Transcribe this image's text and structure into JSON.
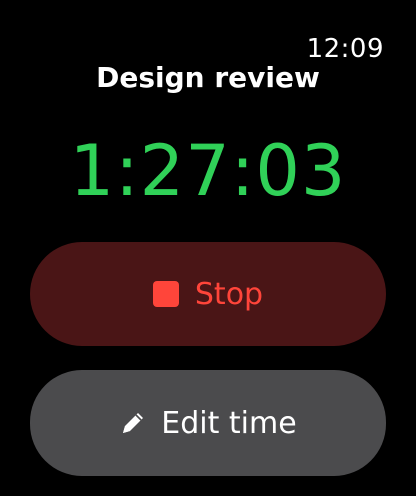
{
  "status_bar": {
    "time": "12:09"
  },
  "timer": {
    "title": "Design review",
    "elapsed": "1:27:03"
  },
  "buttons": {
    "stop_label": "Stop",
    "stop_icon": "stop-square-icon",
    "edit_label": "Edit time",
    "edit_icon": "pencil-icon"
  },
  "colors": {
    "background": "#000000",
    "timer_green": "#30d158",
    "stop_red": "#ff453a",
    "stop_button_bg": "#4a1516",
    "edit_button_bg": "#4b4b4d",
    "text_white": "#ffffff"
  }
}
